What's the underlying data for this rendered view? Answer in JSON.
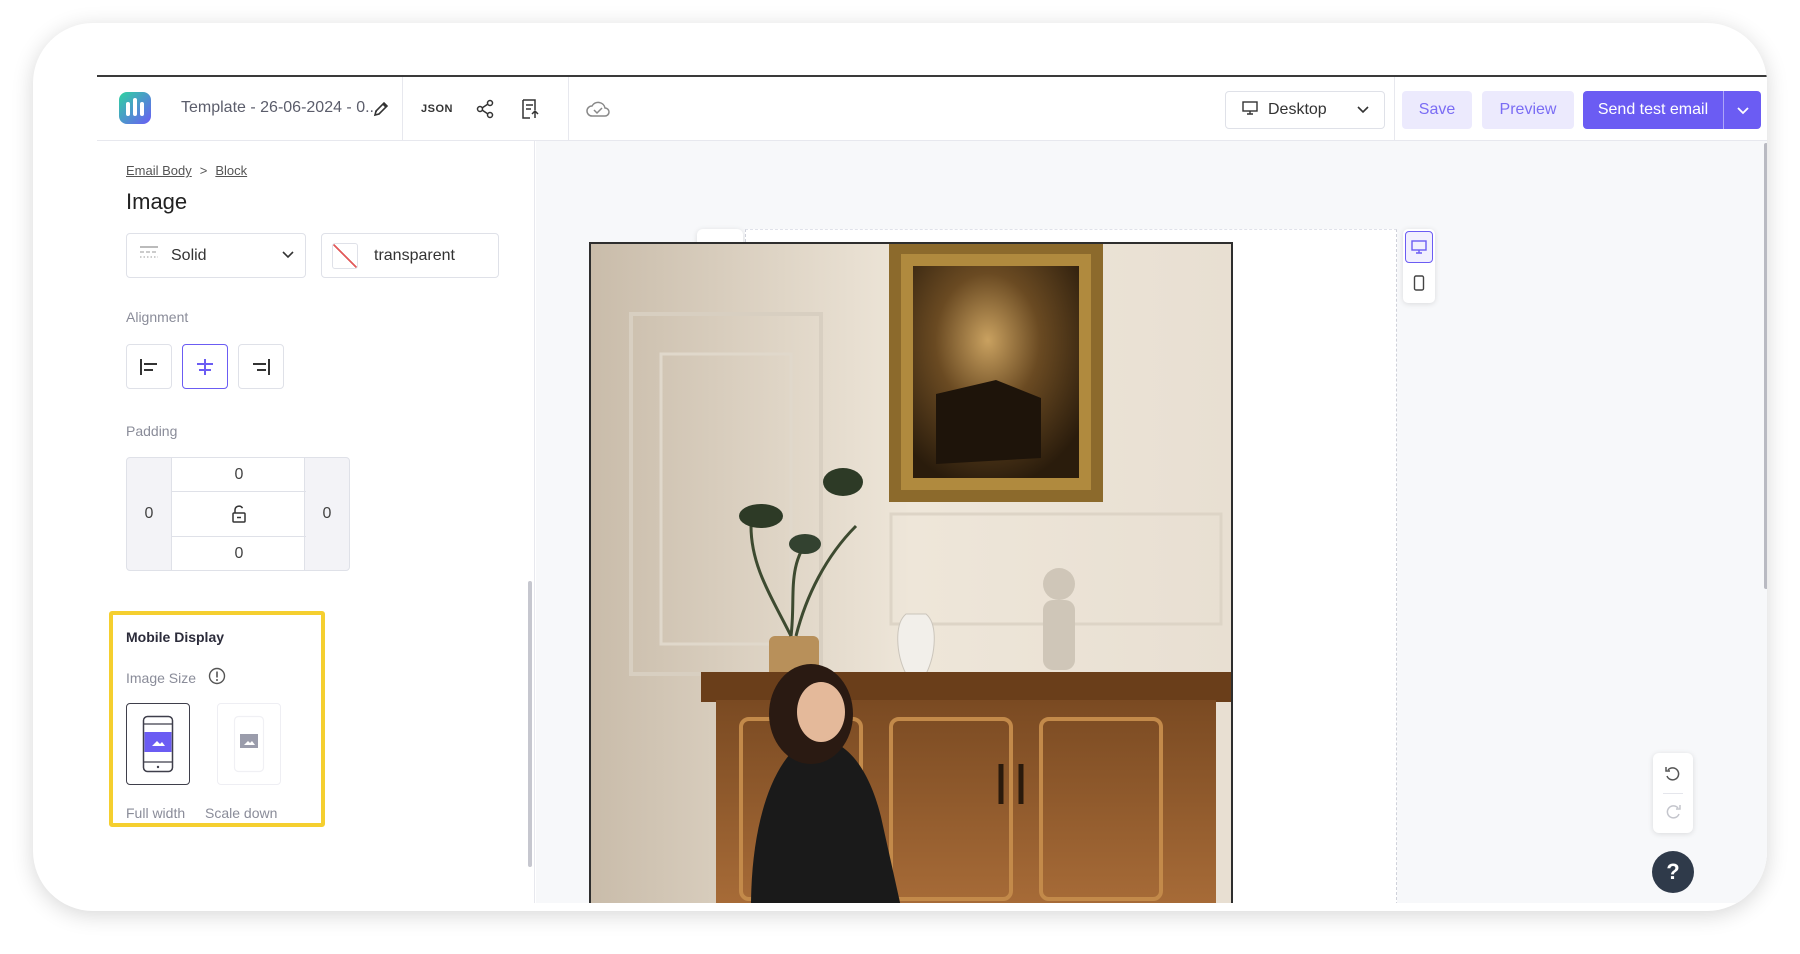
{
  "header": {
    "template_title": "Template - 26-06-2024 - 0...",
    "json_label": "JSON",
    "device": "Desktop",
    "save_label": "Save",
    "preview_label": "Preview",
    "send_label": "Send test email"
  },
  "panel": {
    "breadcrumb": [
      "Email Body",
      "Block"
    ],
    "breadcrumb_sep": ">",
    "title": "Image",
    "border_style": "Solid",
    "border_color": "transparent",
    "alignment_label": "Alignment",
    "padding_label": "Padding",
    "padding": {
      "top": "0",
      "left": "0",
      "right": "0",
      "bottom": "0"
    },
    "mobile": {
      "title": "Mobile Display",
      "image_size_label": "Image Size",
      "options": [
        "Full width",
        "Scale down"
      ],
      "selected": "Full width"
    }
  },
  "colors": {
    "accent": "#6b5cf3",
    "highlight": "#f5cf2f",
    "help_button": "#2f3a4a"
  },
  "icons": [
    "edit-icon",
    "share-icon",
    "export-icon",
    "cloud-icon",
    "monitor-icon",
    "chevron-down-icon",
    "lock-icon",
    "info-icon",
    "add-folder-icon",
    "copy-icon",
    "trash-icon",
    "mobile-icon",
    "undo-icon",
    "redo-icon",
    "help-icon"
  ]
}
